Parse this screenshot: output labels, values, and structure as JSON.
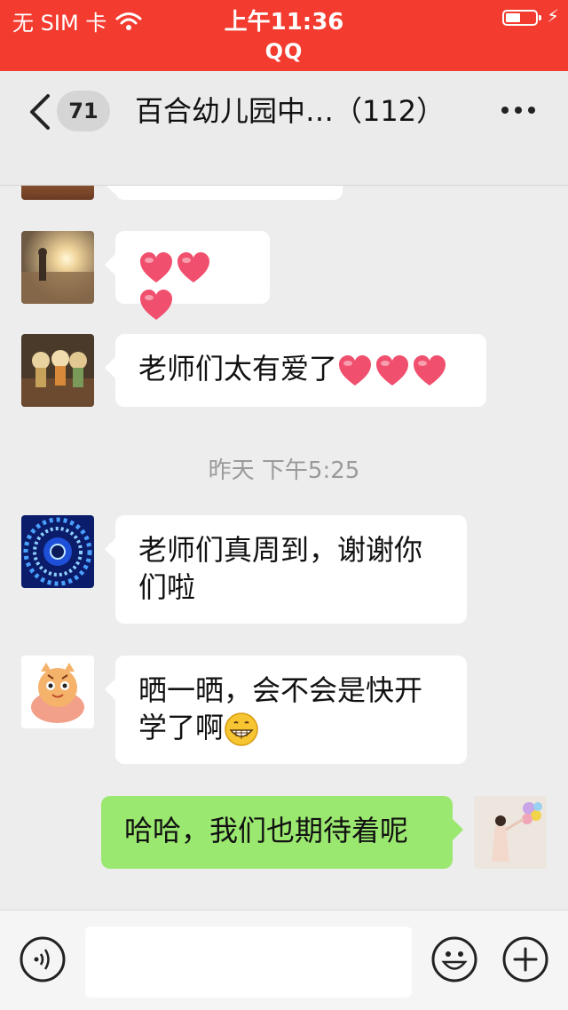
{
  "status_bar": {
    "carrier": "无 SIM 卡",
    "time": "上午11:36",
    "app_name": "QQ"
  },
  "nav": {
    "back_badge": "71",
    "title": "百合幼儿园中…（112）"
  },
  "messages": [
    {
      "side": "left",
      "avatar": "sunset-avatar",
      "text": "",
      "hearts": 3
    },
    {
      "side": "left",
      "avatar": "dolls-avatar",
      "text": "老师们太有爱了",
      "hearts": 3
    },
    {
      "side": "left",
      "avatar": "mandala-avatar",
      "text_line1": "老师们真周到，谢谢你",
      "text_line2": "们啦"
    },
    {
      "side": "left",
      "avatar": "tiger-cartoon-avatar",
      "text_line1": "晒一晒，会不会是快开",
      "text_line2": "学了啊",
      "emoji": "grinning-face"
    },
    {
      "side": "right",
      "avatar": "woman-balloons-avatar",
      "text": "哈哈，我们也期待着呢"
    }
  ],
  "timestamp": "昨天 下午5:25",
  "input": {
    "placeholder": ""
  },
  "colors": {
    "status_bar": "#f33b2f",
    "own_bubble": "#9be870",
    "heart": "#f0506e"
  }
}
